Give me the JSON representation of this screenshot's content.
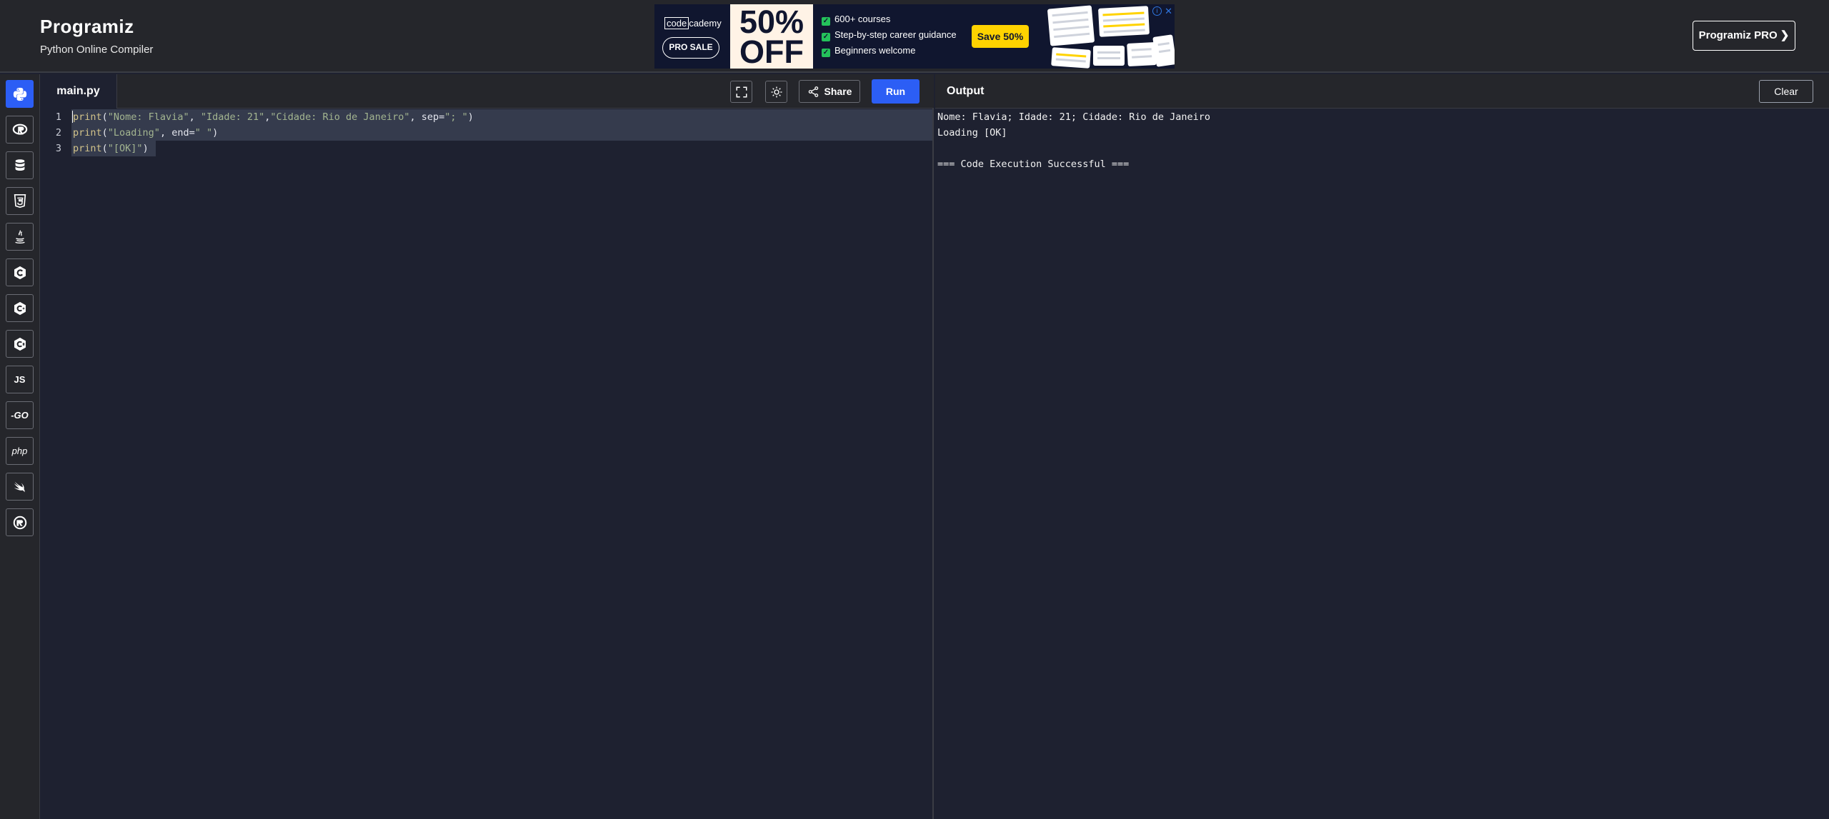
{
  "header": {
    "logo": "Programiz",
    "subtitle": "Python Online Compiler",
    "pro_button": "Programiz PRO ❯"
  },
  "ad": {
    "logo_boxed": "code",
    "logo_rest": "cademy",
    "pro_sale": "PRO SALE",
    "deal_line1": "50%",
    "deal_line2": "OFF",
    "features": [
      "600+ courses",
      "Step-by-step career guidance",
      "Beginners welcome"
    ],
    "save_button": "Save 50%"
  },
  "sidebar": {
    "languages": [
      {
        "icon": "python-icon",
        "active": true
      },
      {
        "icon": "r-icon"
      },
      {
        "icon": "sql-database-icon"
      },
      {
        "icon": "html5-icon"
      },
      {
        "icon": "java-icon"
      },
      {
        "icon": "c-icon"
      },
      {
        "icon": "cpp-icon"
      },
      {
        "icon": "csharp-icon"
      },
      {
        "icon": "javascript-icon",
        "label": "JS"
      },
      {
        "icon": "go-icon",
        "label": "-GO"
      },
      {
        "icon": "php-icon",
        "label": "php"
      },
      {
        "icon": "swift-icon"
      },
      {
        "icon": "rust-icon"
      }
    ]
  },
  "editor": {
    "tab": "main.py",
    "share_label": "Share",
    "run_label": "Run",
    "lines": [
      {
        "num": "1",
        "tokens": [
          {
            "t": "kw",
            "v": "print"
          },
          {
            "t": "pl",
            "v": "("
          },
          {
            "t": "str",
            "v": "\"Nome: Flavia\""
          },
          {
            "t": "pl",
            "v": ", "
          },
          {
            "t": "str",
            "v": "\"Idade: 21\""
          },
          {
            "t": "pl",
            "v": ","
          },
          {
            "t": "str",
            "v": "\"Cidade: Rio de Janeiro\""
          },
          {
            "t": "pl",
            "v": ", sep="
          },
          {
            "t": "str",
            "v": "\"; \""
          },
          {
            "t": "pl",
            "v": ")"
          }
        ]
      },
      {
        "num": "2",
        "tokens": [
          {
            "t": "kw",
            "v": "print"
          },
          {
            "t": "pl",
            "v": "("
          },
          {
            "t": "str",
            "v": "\"Loading\""
          },
          {
            "t": "pl",
            "v": ", end="
          },
          {
            "t": "str",
            "v": "\" \""
          },
          {
            "t": "pl",
            "v": ")"
          }
        ]
      },
      {
        "num": "3",
        "tokens": [
          {
            "t": "kw",
            "v": "print"
          },
          {
            "t": "pl",
            "v": "("
          },
          {
            "t": "str",
            "v": "\"[OK]\""
          },
          {
            "t": "pl",
            "v": ")"
          }
        ]
      }
    ]
  },
  "output": {
    "title": "Output",
    "clear_label": "Clear",
    "lines": [
      "Nome: Flavia; Idade: 21; Cidade: Rio de Janeiro",
      "Loading [OK]",
      "",
      "=== Code Execution Successful ==="
    ]
  },
  "colors": {
    "accent": "#2c5ef5",
    "background": "#1e2130",
    "panel": "#25262b"
  }
}
